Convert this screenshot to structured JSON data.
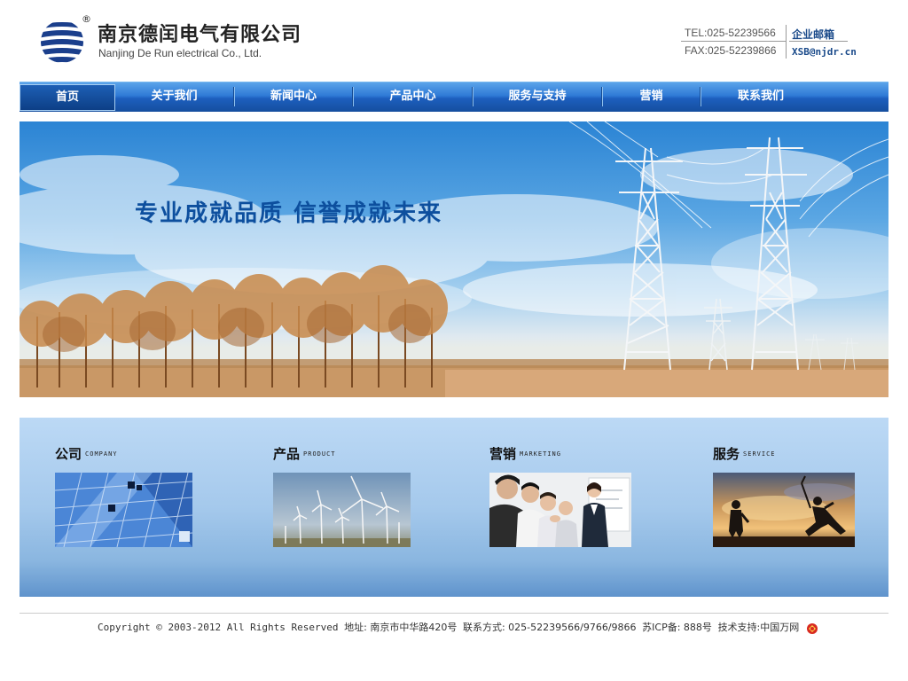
{
  "header": {
    "company_cn": "南京德闰电气有限公司",
    "company_en": "Nanjing De Run  electrical Co., Ltd.",
    "reg_mark": "®",
    "tel": "TEL:025-52239566",
    "fax": "FAX:025-52239866",
    "mail_label": "企业邮箱",
    "mail_addr": "XSB@njdr.cn"
  },
  "nav": {
    "items": [
      {
        "label": "首页",
        "active": true
      },
      {
        "label": "关于我们"
      },
      {
        "label": "新闻中心"
      },
      {
        "label": "产品中心"
      },
      {
        "label": "服务与支持"
      },
      {
        "label": "营销"
      },
      {
        "label": "联系我们"
      }
    ]
  },
  "banner": {
    "slogan": "专业成就品质  信誉成就未来"
  },
  "features": [
    {
      "cn": "公司",
      "en": "COMPANY"
    },
    {
      "cn": "产品",
      "en": "PRODUCT"
    },
    {
      "cn": "营销",
      "en": "MARKETING"
    },
    {
      "cn": "服务",
      "en": "SERVICE"
    }
  ],
  "footer": {
    "copyright": "Copyright © 2003-2012 All Rights Reserved",
    "address": "地址: 南京市中华路420号",
    "contact": "联系方式: 025-52239566/9766/9866",
    "icp": "苏ICP备: 888号",
    "support": "技术支持:中国万网"
  },
  "colors": {
    "nav_blue": "#2f7ad6",
    "slogan": "#0d4f9e",
    "link_blue": "#1a4a8a"
  }
}
